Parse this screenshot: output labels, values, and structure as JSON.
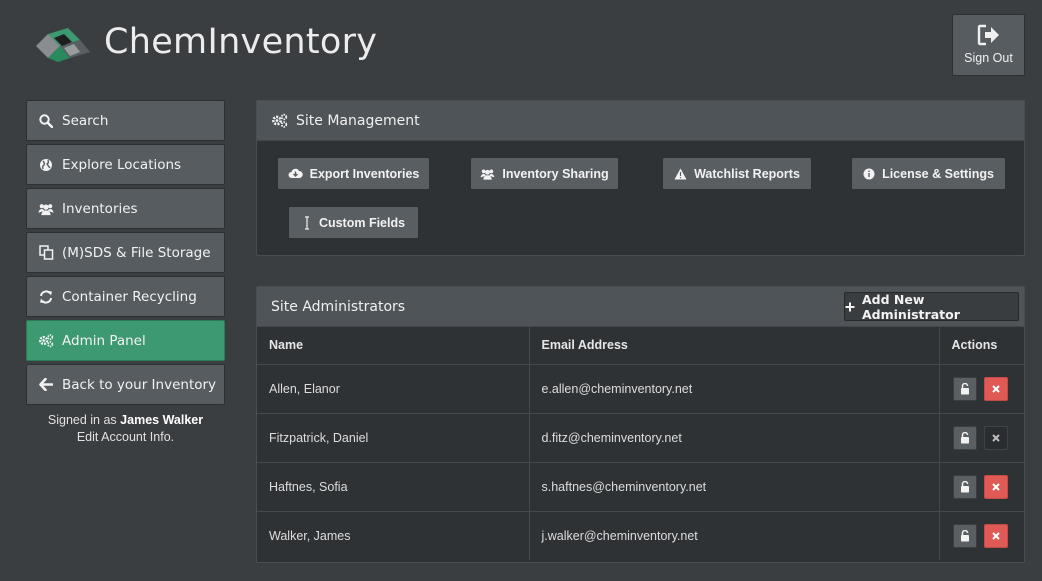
{
  "app": {
    "title": "ChemInventory"
  },
  "header": {
    "signout_label": "Sign Out"
  },
  "sidebar": {
    "items": [
      {
        "label": "Search",
        "icon": "search-icon"
      },
      {
        "label": "Explore Locations",
        "icon": "globe-icon"
      },
      {
        "label": "Inventories",
        "icon": "users-icon"
      },
      {
        "label": "(M)SDS & File Storage",
        "icon": "files-icon"
      },
      {
        "label": "Container Recycling",
        "icon": "refresh-icon"
      },
      {
        "label": "Admin Panel",
        "icon": "gears-icon",
        "active": true
      },
      {
        "label": "Back to your Inventory",
        "icon": "arrow-left-icon"
      }
    ],
    "signed_in_prefix": "Signed in as",
    "user_name": "James Walker",
    "edit_account": "Edit Account Info."
  },
  "site_management": {
    "title": "Site Management",
    "buttons": [
      {
        "label": "Export Inventories",
        "icon": "cloud-download-icon"
      },
      {
        "label": "Inventory Sharing",
        "icon": "users-icon"
      },
      {
        "label": "Watchlist Reports",
        "icon": "warning-icon"
      },
      {
        "label": "License & Settings",
        "icon": "info-icon"
      },
      {
        "label": "Custom Fields",
        "icon": "text-cursor-icon"
      }
    ]
  },
  "administrators": {
    "title": "Site Administrators",
    "add_label": "Add New Administrator",
    "columns": [
      "Name",
      "Email Address",
      "Actions"
    ],
    "rows": [
      {
        "name": "Allen, Elanor",
        "email": "e.allen@cheminventory.net",
        "can_delete": true
      },
      {
        "name": "Fitzpatrick, Daniel",
        "email": "d.fitz@cheminventory.net",
        "can_delete": false
      },
      {
        "name": "Haftnes, Sofia",
        "email": "s.haftnes@cheminventory.net",
        "can_delete": true
      },
      {
        "name": "Walker, James",
        "email": "j.walker@cheminventory.net",
        "can_delete": true
      }
    ]
  },
  "colors": {
    "background": "#3b3e41",
    "accent": "#3d9970",
    "danger": "#e05a55",
    "button": "#575c61"
  }
}
